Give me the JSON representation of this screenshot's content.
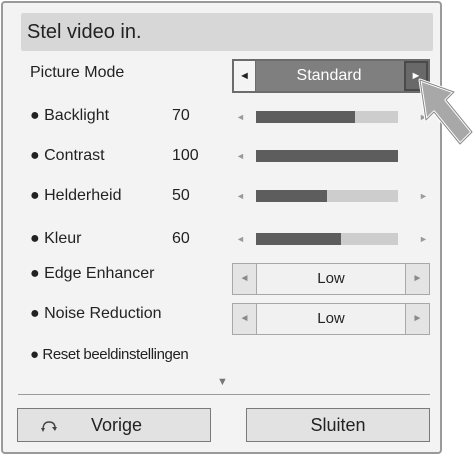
{
  "header": {
    "title": "Stel video in."
  },
  "picture_mode": {
    "label": "Picture Mode",
    "value": "Standard",
    "left_arrow": "◄",
    "right_arrow": "►"
  },
  "settings": [
    {
      "label": "● Backlight",
      "value": "70",
      "level": 0.7
    },
    {
      "label": "● Contrast",
      "value": "100",
      "level": 1.0
    },
    {
      "label": "● Helderheid",
      "value": "50",
      "level": 0.5
    },
    {
      "label": "● Kleur",
      "value": "60",
      "level": 0.6
    }
  ],
  "slider_arrows": {
    "left": "◄",
    "right": "►"
  },
  "options": [
    {
      "label": "● Edge Enhancer",
      "value": "Low"
    },
    {
      "label": "● Noise Reduction",
      "value": "Low"
    }
  ],
  "option_arrows": {
    "left": "◄",
    "right": "►"
  },
  "reset": {
    "label": "● Reset beeldinstellingen"
  },
  "more_indicator": "▼",
  "footer": {
    "back_label": "Vorige",
    "close_label": "Sluiten",
    "back_icon": "back-arrow-icon"
  },
  "pointer_icon": "pointer-arrow-icon",
  "colors": {
    "panel_bg": "#f3f3f3",
    "title_bg": "#d7d7d7",
    "selected_bg": "#7f7f7f",
    "slider_fill": "#5d5d5d",
    "slider_track": "#cdcdcd"
  }
}
